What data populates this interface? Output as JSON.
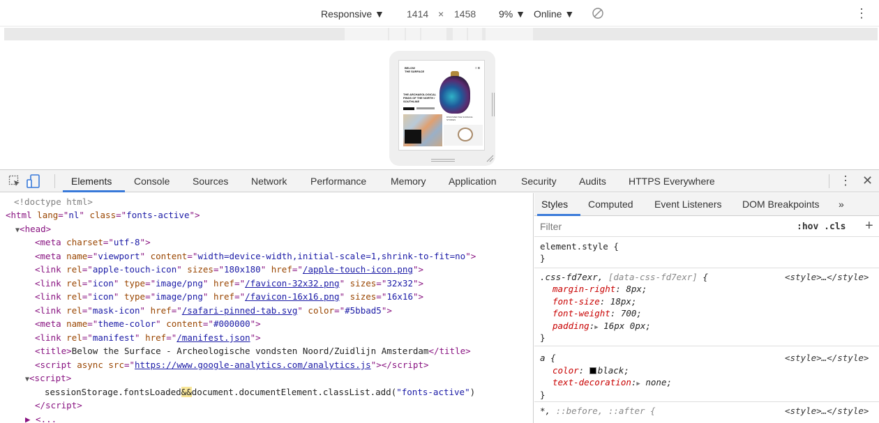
{
  "device_toolbar": {
    "mode_label": "Responsive ▼",
    "width": "1414",
    "times": "×",
    "height": "1458",
    "zoom_label": "9% ▼",
    "network_label": "Online ▼",
    "kebab": "⋮"
  },
  "preview": {
    "logo_line1": "BELOW",
    "logo_line2": "THE SURFACE",
    "menu_glyph": "≡ ⊞",
    "heading": "THE ARCHAEOLOGICAL FINDS OF THE NORTH / SOUTHLINE",
    "right_text": "DISCOVER THE SURFACE STORIES"
  },
  "tabs": {
    "items": [
      "Elements",
      "Console",
      "Sources",
      "Network",
      "Performance",
      "Memory",
      "Application",
      "Security",
      "Audits",
      "HTTPS Everywhere"
    ],
    "kebab": "⋮",
    "close": "✕"
  },
  "elements": {
    "doctype": "<!doctype html>",
    "html_lang": "nl",
    "html_class": "fonts-active",
    "head": "head",
    "meta_charset": "utf-8",
    "viewport_content": "width=device-width,initial-scale=1,shrink-to-fit=no",
    "apple_sizes": "180x180",
    "apple_href": "/apple-touch-icon.png",
    "icon32_type": "image/png",
    "icon32_href": "/favicon-32x32.png",
    "icon32_sizes": "32x32",
    "icon16_type": "image/png",
    "icon16_href": "/favicon-16x16.png",
    "icon16_sizes": "16x16",
    "mask_href": "/safari-pinned-tab.svg",
    "mask_color": "#5bbad5",
    "theme_content": "#000000",
    "manifest_href": "/manifest.json",
    "title_text": "Below the Surface - Archeologische vondsten Noord/Zuidlijn Amsterdam",
    "ga_src": "https://www.google-analytics.com/analytics.js",
    "script_body_pre": "sessionStorage.fontsLoaded",
    "script_body_and": "&&",
    "script_body_mid": "document.documentElement.classList.add(",
    "script_body_str": "\"fonts-active\"",
    "script_body_end": ")",
    "partial": "▶ <..."
  },
  "styles": {
    "tabs": [
      "Styles",
      "Computed",
      "Event Listeners",
      "DOM Breakpoints",
      "»"
    ],
    "filter_placeholder": "Filter",
    "hov_cls": ":hov .cls",
    "plus": "+",
    "element_style": "element.style {",
    "close_brace": "}",
    "rule1_selector": ".css-fd7exr,",
    "rule1_selector2": "[data-css-fd7exr]",
    "rule1_open": "{",
    "rule1_src": "<style>…</style>",
    "rule1_props": [
      {
        "name": "margin-right",
        "value": "8px;"
      },
      {
        "name": "font-size",
        "value": "18px;"
      },
      {
        "name": "font-weight",
        "value": "700;"
      },
      {
        "name": "padding",
        "value": "16px 0px;"
      }
    ],
    "rule2_selector": "a {",
    "rule2_src": "<style>…</style>",
    "rule2_color_name": "color",
    "rule2_color_value": "black;",
    "rule2_td_name": "text-decoration",
    "rule2_td_value": "none;",
    "rule3_selector": "*,",
    "rule3_selector2": "::before, ::after {",
    "rule3_src": "<style>…</style>"
  }
}
